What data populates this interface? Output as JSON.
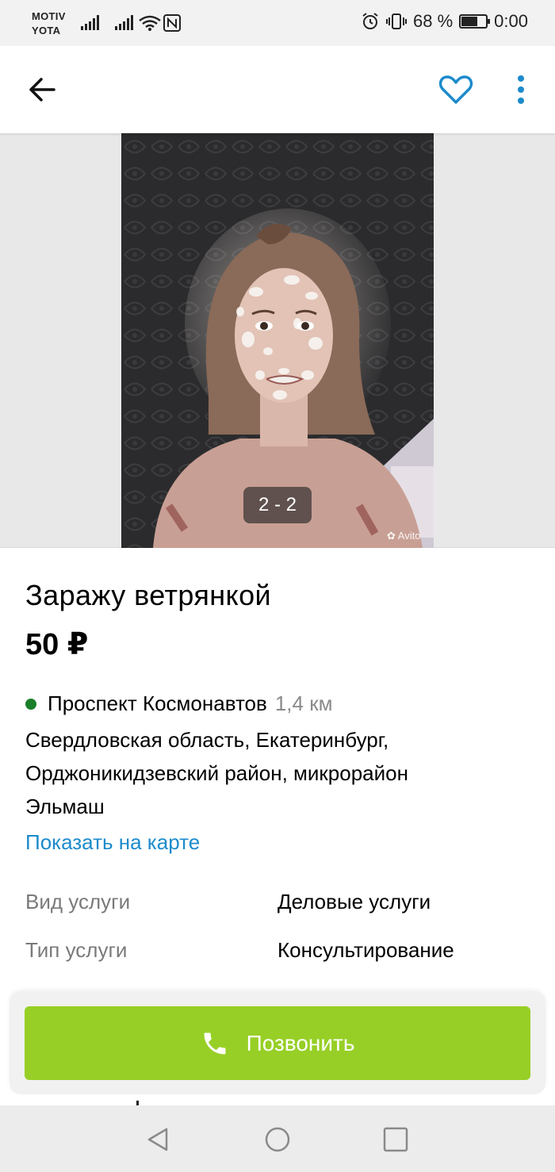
{
  "status_bar": {
    "carrier_1": "MOTIV",
    "carrier_2": "YOTA",
    "battery_percent": "68 %",
    "battery_level": 0.68,
    "time": "0:00",
    "icons": [
      "signal-icon",
      "signal-icon",
      "wifi-icon",
      "nfc-icon",
      "alarm-icon",
      "vibrate-icon",
      "battery-icon"
    ]
  },
  "app_bar": {
    "icons": [
      "back-arrow-icon",
      "heart-icon",
      "more-vert-icon"
    ],
    "accent_color": "#1c8bcc"
  },
  "gallery": {
    "counter": "2 - 2",
    "watermark": "Avito"
  },
  "listing": {
    "title": "Заражу ветрянкой",
    "price": "50 ₽",
    "metro": {
      "station": "Проспект Космонавтов",
      "distance": "1,4 км",
      "line_color": "#1a7f2a"
    },
    "address_line_1": "Свердловская область, Екатеринбург,",
    "address_line_2": "Орджоникидзевский район, микрорайон",
    "address_line_3": "Эльмаш",
    "map_link": "Показать на карте",
    "params": [
      {
        "label": "Вид услуги",
        "value": "Деловые услуги"
      },
      {
        "label": "Тип услуги",
        "value": "Консультирование"
      }
    ]
  },
  "call_button": {
    "label": "Позвонить",
    "color": "#97cf26"
  },
  "nav_bar": {
    "icons": [
      "back-triangle-icon",
      "home-circle-icon",
      "recents-square-icon"
    ]
  }
}
